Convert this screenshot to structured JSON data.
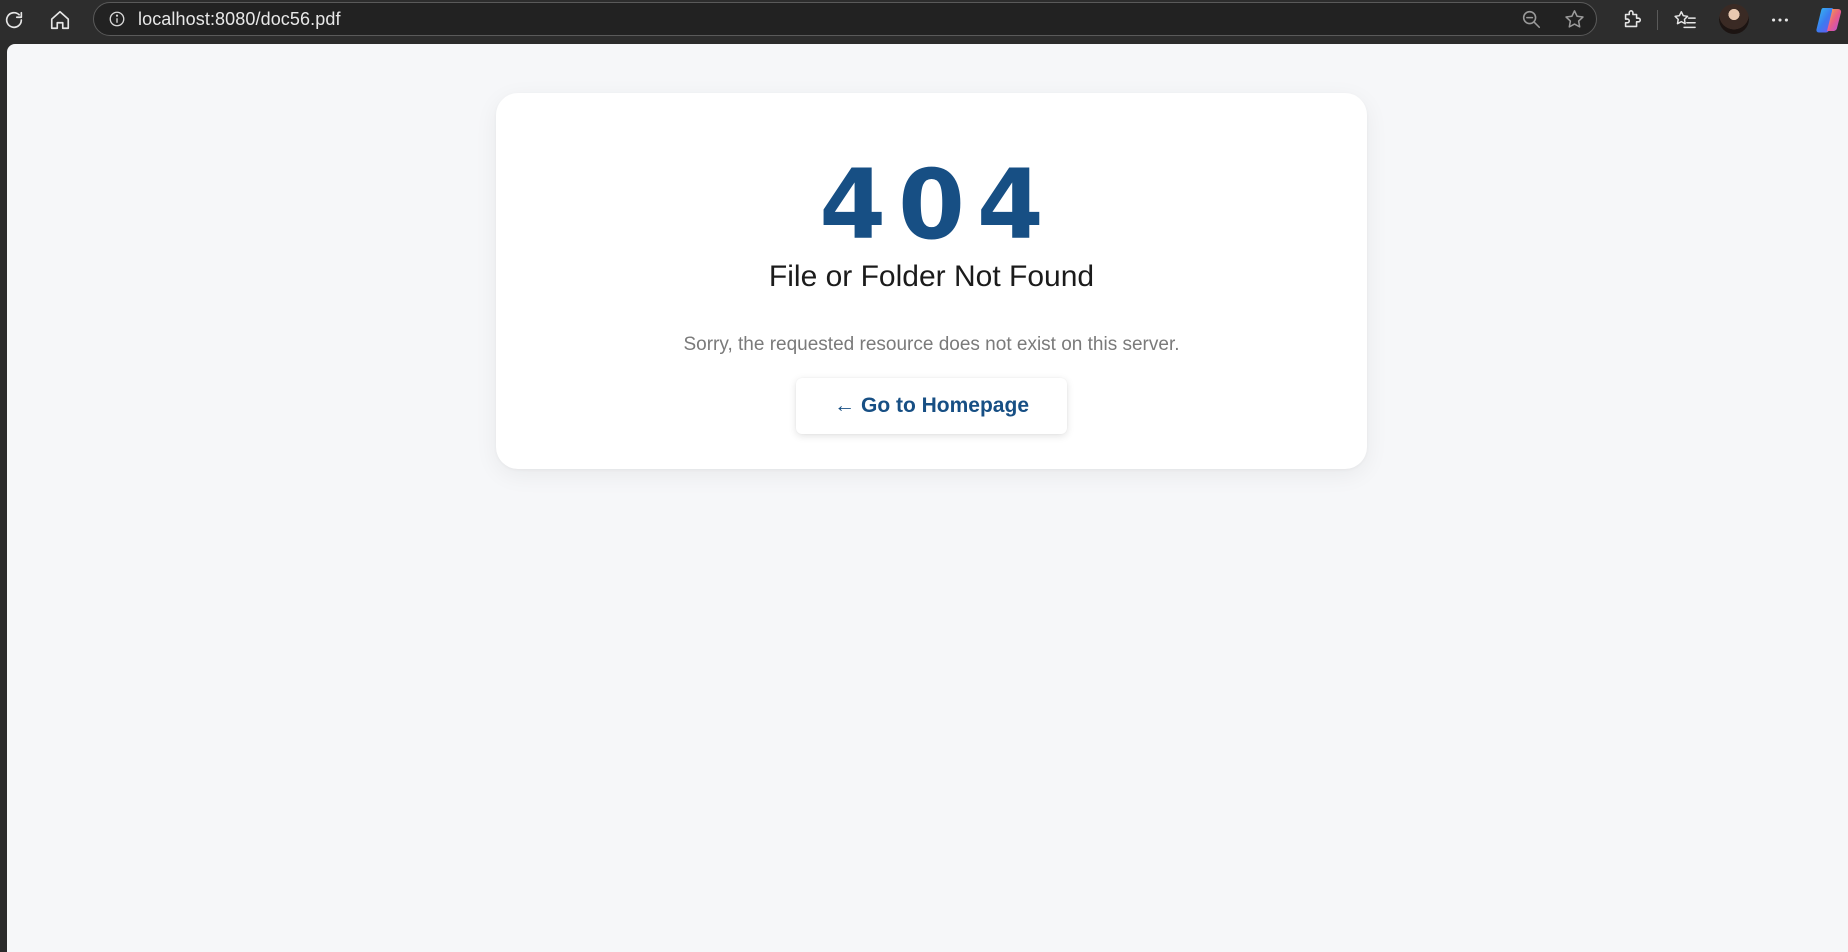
{
  "browser": {
    "url": "localhost:8080/doc56.pdf",
    "icons": [
      "reload-icon",
      "home-icon",
      "info-icon",
      "zoom-out-icon",
      "star-icon",
      "extensions-icon",
      "favorites-icon",
      "profile-avatar",
      "more-icon",
      "copilot-icon"
    ]
  },
  "page": {
    "error_code": "404",
    "title": "File or Folder Not Found",
    "message": "Sorry, the requested resource does not exist on this server.",
    "home_button": {
      "arrow": "←",
      "label": "Go to Homepage"
    }
  },
  "colors": {
    "accent": "#174f84",
    "page_background": "#f6f7f9",
    "card_background": "#ffffff",
    "toolbar_background": "#2d2d2d"
  }
}
